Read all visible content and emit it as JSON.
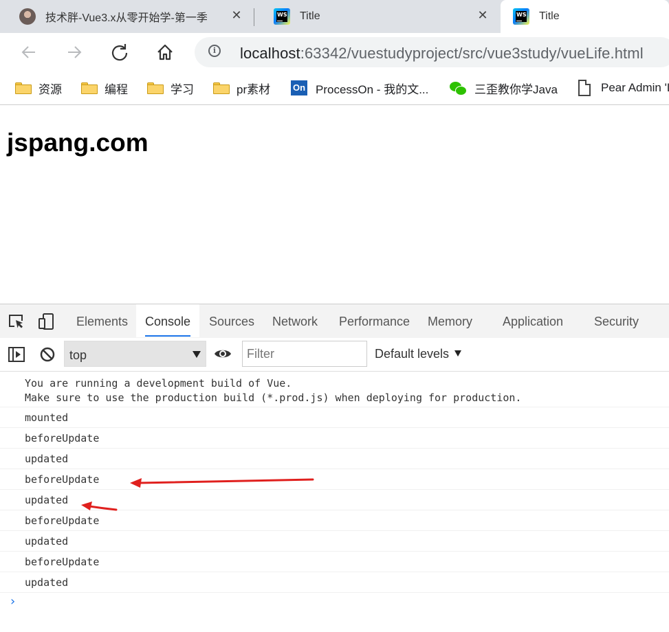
{
  "tabs": [
    {
      "title": "技术胖-Vue3.x从零开始学-第一季",
      "icon": "avatar-icon"
    },
    {
      "title": "Title",
      "icon": "webstorm-icon"
    },
    {
      "title": "Title",
      "icon": "webstorm-icon",
      "active": true
    }
  ],
  "address_bar": {
    "host": "localhost",
    "rest": ":63342/vuestudyproject/src/vue3study/vueLife.html"
  },
  "bookmarks": [
    {
      "label": "资源",
      "icon": "folder-icon"
    },
    {
      "label": "编程",
      "icon": "folder-icon"
    },
    {
      "label": "学习",
      "icon": "folder-icon"
    },
    {
      "label": "pr素材",
      "icon": "folder-icon"
    },
    {
      "label": "ProcessOn - 我的文...",
      "icon": "processon-icon",
      "icon_text": "On"
    },
    {
      "label": "三歪教你学Java",
      "icon": "wechat-icon"
    },
    {
      "label": "Pear Admin 'Layui",
      "icon": "page-icon"
    }
  ],
  "page": {
    "heading": "jspang.com"
  },
  "devtools": {
    "tabs": [
      "Elements",
      "Console",
      "Sources",
      "Network",
      "Performance",
      "Memory",
      "Application",
      "Security"
    ],
    "active_tab": "Console",
    "context": "top",
    "filter_placeholder": "Filter",
    "levels": "Default levels",
    "messages": [
      "You are running a development build of Vue.\nMake sure to use the production build (*.prod.js) when deploying for production.",
      "mounted",
      "beforeUpdate",
      "updated",
      "beforeUpdate",
      "updated",
      "beforeUpdate",
      "updated",
      "beforeUpdate",
      "updated"
    ],
    "prompt": "›"
  },
  "colors": {
    "annotation": "#e0201e",
    "accent": "#1a73e8",
    "tabstrip": "#dee1e6"
  }
}
